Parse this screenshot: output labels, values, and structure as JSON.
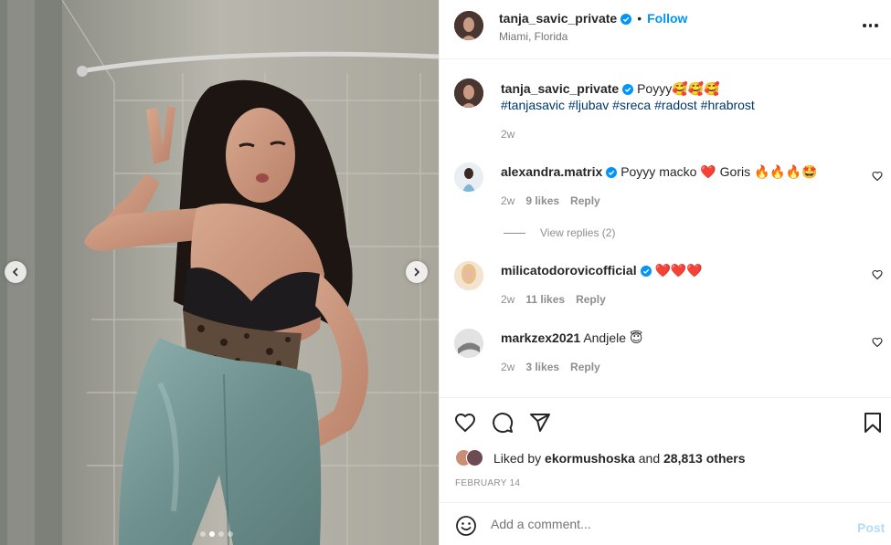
{
  "post": {
    "author": "tanja_savic_private",
    "location": "Miami, Florida",
    "follow_label": "Follow",
    "follow_separator": "•",
    "caption_text": "Poyyy🥰🥰🥰",
    "caption_hashtags": "#tanjasavic #ljubav #sreca #radost #hrabrost",
    "caption_age": "2w",
    "media_dots": 4,
    "media_active_dot": 1
  },
  "comments": [
    {
      "username": "alexandra.matrix",
      "verified": true,
      "text": "Poyyy macko ❤️  Goris 🔥🔥🔥🤩",
      "age": "2w",
      "likes": "9 likes",
      "reply": "Reply"
    },
    {
      "username": "milicatodorovicofficial",
      "verified": true,
      "text": "❤️❤️❤️",
      "age": "2w",
      "likes": "11 likes",
      "reply": "Reply"
    },
    {
      "username": "markzex2021",
      "verified": false,
      "text": "Andjele 😇",
      "age": "2w",
      "likes": "3 likes",
      "reply": "Reply"
    }
  ],
  "view_replies": "View replies (2)",
  "likes": {
    "prefix": "Liked by",
    "user": "ekormushoska",
    "middle": "and",
    "others": "28,813 others"
  },
  "date": "FEBRUARY 14",
  "add_comment": {
    "placeholder": "Add a comment...",
    "post_label": "Post"
  },
  "colors": {
    "accent": "#0095f6",
    "hashtag": "#00376b",
    "secondary_text": "#8e8e8e",
    "post_disabled": "#b3dbff"
  },
  "icons": {
    "more": "more-horizontal-icon",
    "like": "heart-icon",
    "comment": "comment-icon",
    "share": "share-icon",
    "save": "bookmark-icon",
    "emoji": "emoji-icon",
    "verified": "verified-badge-icon",
    "prev": "chevron-left-icon",
    "next": "chevron-right-icon"
  }
}
